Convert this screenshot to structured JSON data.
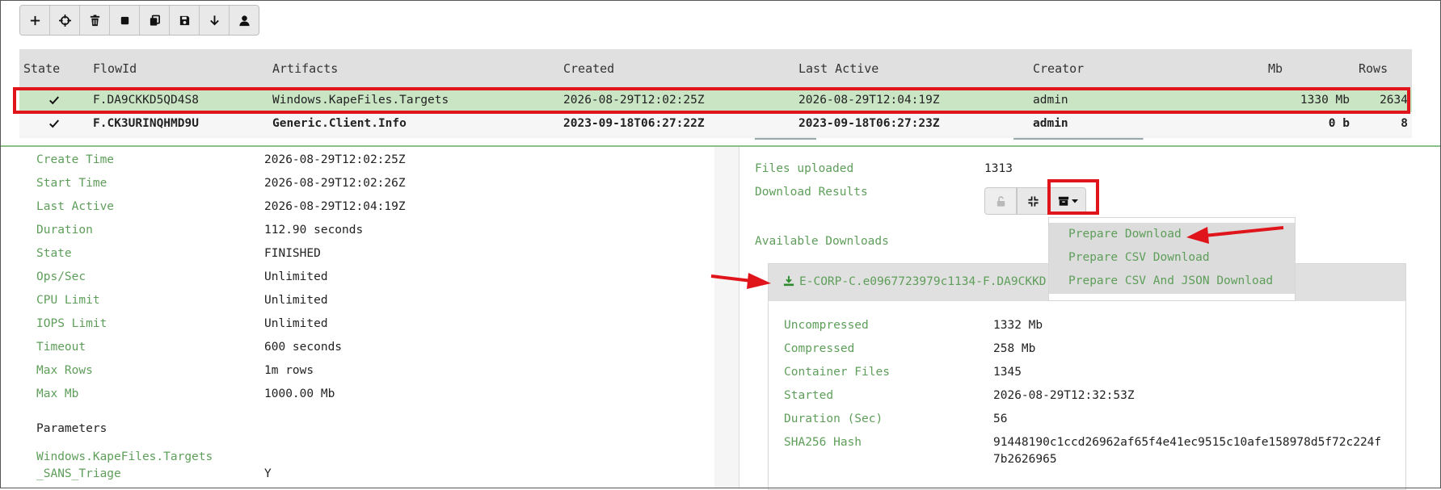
{
  "toolbar": {
    "buttons": [
      "add-icon",
      "crosshair-icon",
      "trash-icon",
      "stop-icon",
      "copy-icon",
      "save-icon",
      "download-arrow-icon",
      "user-icon"
    ]
  },
  "table": {
    "headers": {
      "state": "State",
      "flowid": "FlowId",
      "artifacts": "Artifacts",
      "created": "Created",
      "last_active": "Last Active",
      "creator": "Creator",
      "mb": "Mb",
      "rows": "Rows"
    },
    "rows": [
      {
        "flowid": "F.DA9CKKD5QD4S8",
        "artifacts": "Windows.KapeFiles.Targets",
        "created": "2026-08-29T12:02:25Z",
        "last_active": "2026-08-29T12:04:19Z",
        "creator": "admin",
        "mb": "1330 Mb",
        "rows": "2634"
      },
      {
        "flowid": "F.CK3URINQHMD9U",
        "artifacts": "Generic.Client.Info",
        "created": "2023-09-18T06:27:22Z",
        "last_active": "2023-09-18T06:27:23Z",
        "creator": "admin",
        "mb": "0 b",
        "rows": "8"
      }
    ]
  },
  "details": {
    "create_time_label": "Create Time",
    "create_time": "2026-08-29T12:02:25Z",
    "start_time_label": "Start Time",
    "start_time": "2026-08-29T12:02:26Z",
    "last_active_label": "Last Active",
    "last_active": "2026-08-29T12:04:19Z",
    "duration_label": "Duration",
    "duration": "112.90 seconds",
    "state_label": "State",
    "state": "FINISHED",
    "ops_label": "Ops/Sec",
    "ops": "Unlimited",
    "cpu_label": "CPU Limit",
    "cpu": "Unlimited",
    "iops_label": "IOPS Limit",
    "iops": "Unlimited",
    "timeout_label": "Timeout",
    "timeout": "600 seconds",
    "max_rows_label": "Max Rows",
    "max_rows": "1m rows",
    "max_mb_label": "Max Mb",
    "max_mb": "1000.00 Mb",
    "parameters_title": "Parameters",
    "param_artifact": "Windows.KapeFiles.Targets",
    "param_name": "_SANS_Triage",
    "param_value": "Y"
  },
  "right": {
    "files_uploaded_label": "Files uploaded",
    "files_uploaded": "1313",
    "download_results_label": "Download Results",
    "available_downloads_label": "Available Downloads",
    "dropdown_items": [
      "Prepare Download",
      "Prepare CSV Download",
      "Prepare CSV And JSON Download"
    ],
    "download_file": "E-CORP-C.e0967723979c1134-F.DA9CKKD",
    "uncompressed_label": "Uncompressed",
    "uncompressed": "1332 Mb",
    "compressed_label": "Compressed",
    "compressed": "258 Mb",
    "container_files_label": "Container Files",
    "container_files": "1345",
    "started_label": "Started",
    "started": "2026-08-29T12:32:53Z",
    "duration_sec_label": "Duration (Sec)",
    "duration_sec": "56",
    "sha_label": "SHA256 Hash",
    "sha_line1": "91448190c1ccd26962af65f4e41ec9515c10afe158978d5f72c224f",
    "sha_line2": "7b2626965"
  },
  "colors": {
    "highlight": "#e0141b",
    "accent_green": "#5e9e5a",
    "selected_row": "#c9e5c4"
  }
}
